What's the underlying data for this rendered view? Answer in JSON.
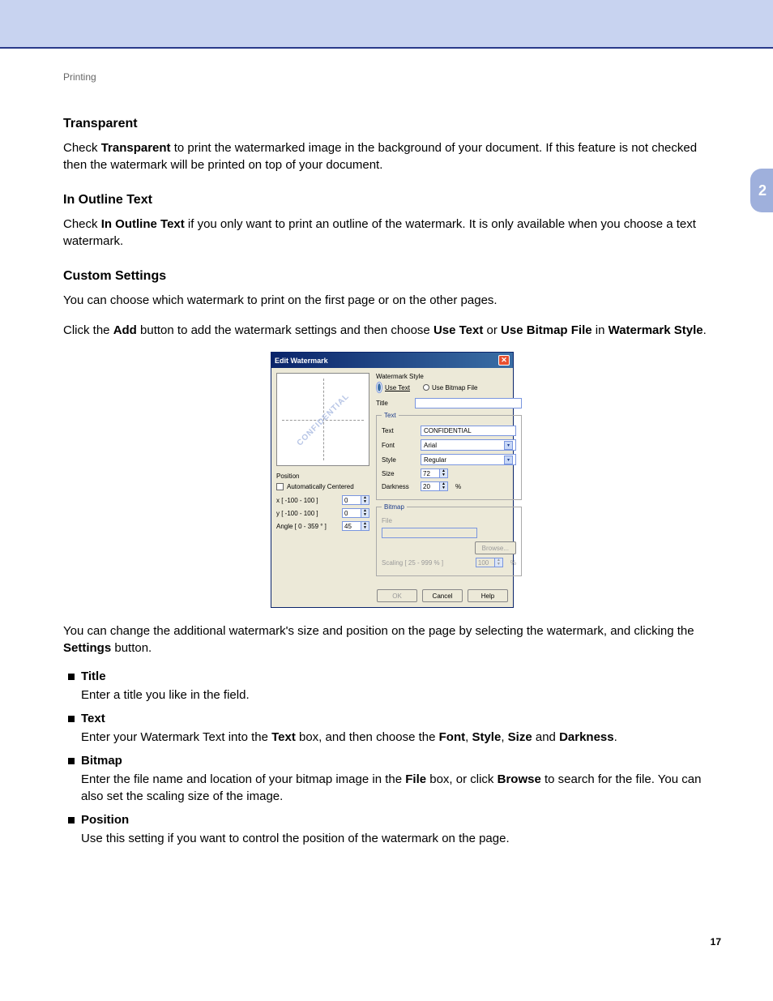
{
  "header": "Printing",
  "chapter": "2",
  "pageNumber": "17",
  "sections": {
    "transparent": {
      "title": "Transparent",
      "lead": "Check ",
      "kw": "Transparent",
      "rest": " to print the watermarked image in the background of your document. If this feature is not checked then the watermark will be printed on top of your document."
    },
    "outline": {
      "title": "In Outline Text",
      "lead": "Check ",
      "kw": "In Outline Text",
      "rest": " if you only want to print an outline of the watermark. It is only available when you choose a text watermark."
    },
    "custom": {
      "title": "Custom Settings",
      "p1": "You can choose which watermark to print on the first page or on the other pages.",
      "p2a": "Click the ",
      "p2_add": "Add",
      "p2b": " button to add the watermark settings and then choose ",
      "p2_ut": "Use Text",
      "p2c": " or ",
      "p2_ub": "Use Bitmap File",
      "p2d": " in ",
      "p2_ws": "Watermark Style",
      "p2e": "."
    },
    "after": {
      "p_a": "You can change the additional watermark's size and position on the page by selecting the watermark, and clicking the ",
      "p_b": "Settings",
      "p_c": " button."
    }
  },
  "bullets": {
    "title": {
      "label": "Title",
      "desc": "Enter a title you like in the field."
    },
    "text": {
      "label": "Text",
      "a": "Enter your Watermark Text into the ",
      "kwText": "Text",
      "b": " box, and then choose the ",
      "kwFont": "Font",
      "c": ", ",
      "kwStyle": "Style",
      "d": ", ",
      "kwSize": "Size",
      "e": " and ",
      "kwDark": "Darkness",
      "f": "."
    },
    "bitmap": {
      "label": "Bitmap",
      "a": "Enter the file name and location of your bitmap image in the ",
      "kwFile": "File",
      "b": " box, or click ",
      "kwBrowse": "Browse",
      "c": " to search for the file. You can also set the scaling size of the image."
    },
    "position": {
      "label": "Position",
      "desc": "Use this setting if you want to control the position of the watermark on the page."
    }
  },
  "dlg": {
    "title": "Edit Watermark",
    "wmText": "CONFIDENTIAL",
    "position": "Position",
    "autoCenter": "Automatically Centered",
    "xlabel": "x [ -100 - 100 ]",
    "ylabel": "y [ -100 - 100 ]",
    "anglelabel": "Angle [ 0 - 359 ° ]",
    "xval": "0",
    "yval": "0",
    "angleval": "45",
    "styleLabel": "Watermark Style",
    "useText": "Use Text",
    "useBitmap": "Use Bitmap File",
    "titleLabel": "Title",
    "textGroup": "Text",
    "textLbl": "Text",
    "textVal": "CONFIDENTIAL",
    "fontLbl": "Font",
    "fontVal": "Arial",
    "styleLbl": "Style",
    "styleVal": "Regular",
    "sizeLbl": "Size",
    "sizeVal": "72",
    "darkLbl": "Darkness",
    "darkVal": "20",
    "pct": "%",
    "bitmapGroup": "Bitmap",
    "fileLbl": "File",
    "browse": "Browse...",
    "scaling": "Scaling [ 25 - 999 % ]",
    "scaleVal": "100",
    "ok": "OK",
    "cancel": "Cancel",
    "help": "Help"
  }
}
